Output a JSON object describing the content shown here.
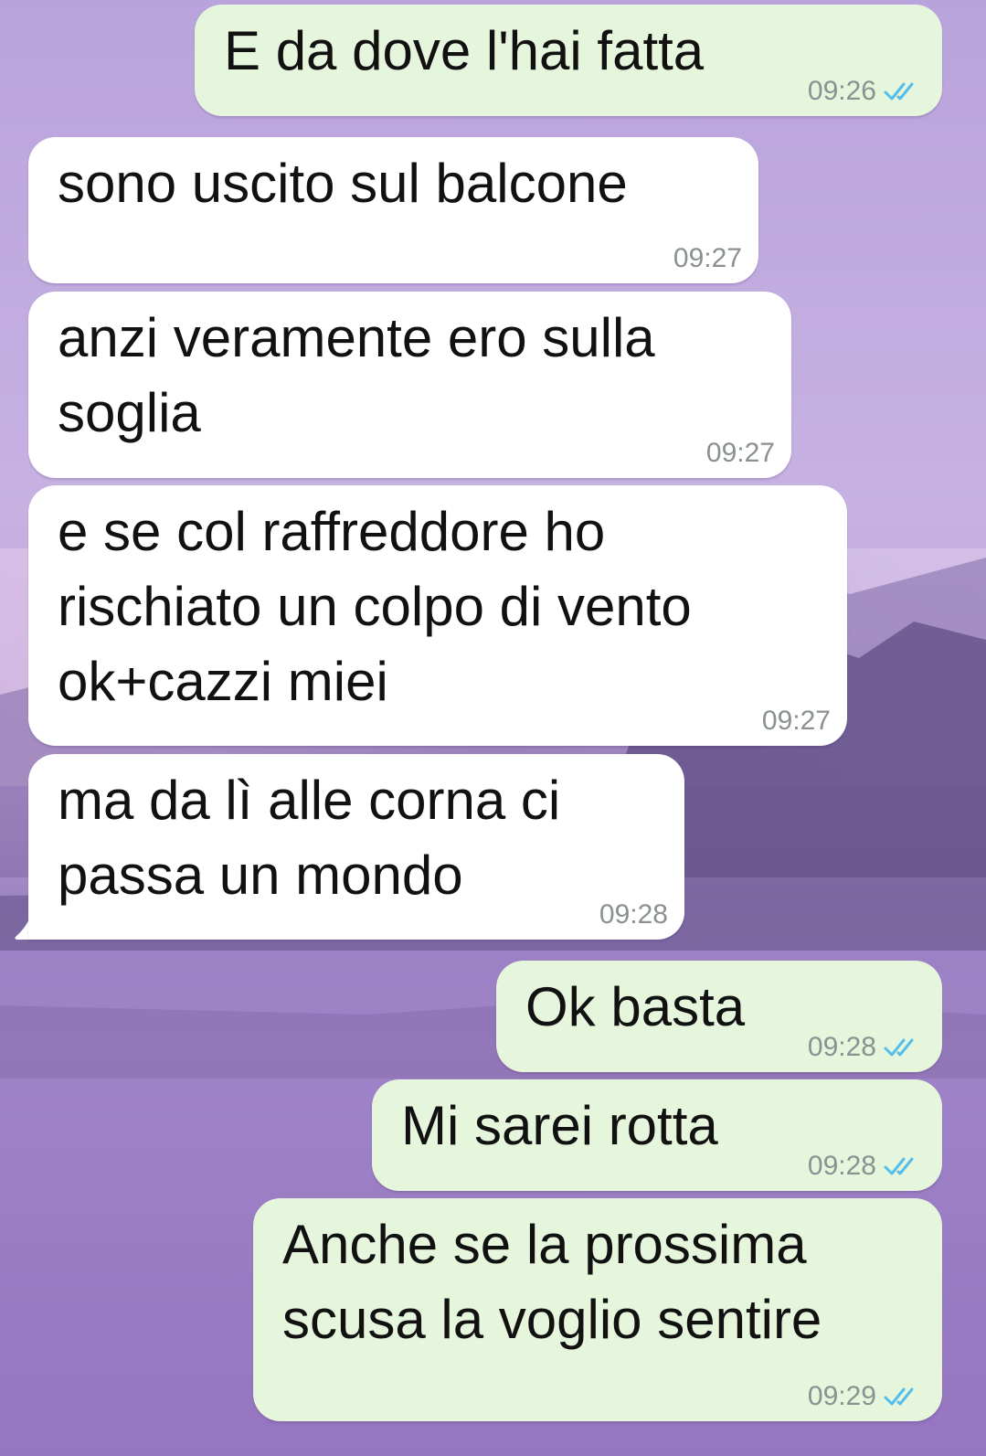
{
  "chat": {
    "messages": [
      {
        "direction": "outgoing",
        "text": "E da dove l'hai fatta",
        "time": "09:26",
        "status_icon": "double-check-icon"
      },
      {
        "direction": "incoming",
        "text": "sono uscito sul balcone",
        "time": "09:27"
      },
      {
        "direction": "incoming",
        "text": "anzi veramente ero sulla\nsoglia",
        "time": "09:27"
      },
      {
        "direction": "incoming",
        "text": "e se col raffreddore ho\nrischiato un colpo di vento\nok+cazzi miei",
        "time": "09:27"
      },
      {
        "direction": "incoming",
        "text": "ma da lì alle corna ci\npassa un mondo",
        "time": "09:28"
      },
      {
        "direction": "outgoing",
        "text": "Ok basta",
        "time": "09:28",
        "status_icon": "double-check-icon"
      },
      {
        "direction": "outgoing",
        "text": "Mi sarei rotta",
        "time": "09:28",
        "status_icon": "double-check-icon"
      },
      {
        "direction": "outgoing",
        "text": "Anche se la prossima\nscusa la voglio sentire",
        "time": "09:29",
        "status_icon": "double-check-icon"
      }
    ]
  },
  "colors": {
    "outgoing_bubble": "#e6f6dd",
    "incoming_bubble": "#ffffff",
    "read_tick": "#53bdeb",
    "time_text": "#8a9190"
  }
}
